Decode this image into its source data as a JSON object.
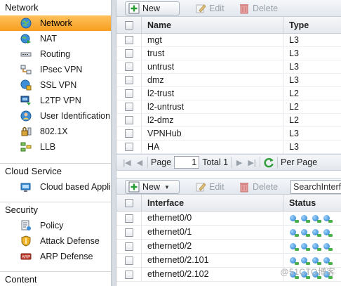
{
  "sidebar": {
    "network": {
      "title": "Network",
      "items": [
        {
          "label": "Network",
          "icon": "globe-icon",
          "selected": true
        },
        {
          "label": "NAT",
          "icon": "globe-arrow-icon"
        },
        {
          "label": "Routing",
          "icon": "router-icon"
        },
        {
          "label": "IPsec VPN",
          "icon": "vpn-tunnel-icon"
        },
        {
          "label": "SSL VPN",
          "icon": "ssl-globe-icon"
        },
        {
          "label": "L2TP VPN",
          "icon": "l2tp-icon"
        },
        {
          "label": "User Identification",
          "icon": "user-id-icon"
        },
        {
          "label": "802.1X",
          "icon": "lock-network-icon"
        },
        {
          "label": "LLB",
          "icon": "load-balance-icon"
        }
      ]
    },
    "cloud": {
      "title": "Cloud Service",
      "items": [
        {
          "label": "Cloud based Application",
          "icon": "cloud-monitor-icon"
        }
      ]
    },
    "security": {
      "title": "Security",
      "items": [
        {
          "label": "Policy",
          "icon": "policy-icon"
        },
        {
          "label": "Attack Defense",
          "icon": "shield-icon"
        },
        {
          "label": "ARP Defense",
          "icon": "arp-icon"
        }
      ]
    },
    "content": {
      "title": "Content"
    }
  },
  "zones": {
    "toolbar": {
      "new": "New",
      "edit": "Edit",
      "delete": "Delete"
    },
    "columns": {
      "name": "Name",
      "type": "Type"
    },
    "rows": [
      {
        "name": "mgt",
        "type": "L3"
      },
      {
        "name": "trust",
        "type": "L3"
      },
      {
        "name": "untrust",
        "type": "L3"
      },
      {
        "name": "dmz",
        "type": "L3"
      },
      {
        "name": "l2-trust",
        "type": "L2"
      },
      {
        "name": "l2-untrust",
        "type": "L2"
      },
      {
        "name": "l2-dmz",
        "type": "L2"
      },
      {
        "name": "VPNHub",
        "type": "L3"
      },
      {
        "name": "HA",
        "type": "L3"
      }
    ],
    "pager": {
      "page_label": "Page",
      "page_value": "1",
      "total_label": "Total 1",
      "per_page_label": "Per Page"
    }
  },
  "interfaces": {
    "toolbar": {
      "new": "New",
      "edit": "Edit",
      "delete": "Delete",
      "search_placeholder": "SearchInterface"
    },
    "columns": {
      "interface": "Interface",
      "status": "Status"
    },
    "rows": [
      {
        "interface": "ethernet0/0"
      },
      {
        "interface": "ethernet0/1"
      },
      {
        "interface": "ethernet0/2"
      },
      {
        "interface": "ethernet0/2.101"
      },
      {
        "interface": "ethernet0/2.102"
      }
    ]
  },
  "watermark": "@51CTO博客",
  "colors": {
    "selected": "#f7a325",
    "link_green": "#49b24a",
    "status_blue": "#1f78c8"
  }
}
